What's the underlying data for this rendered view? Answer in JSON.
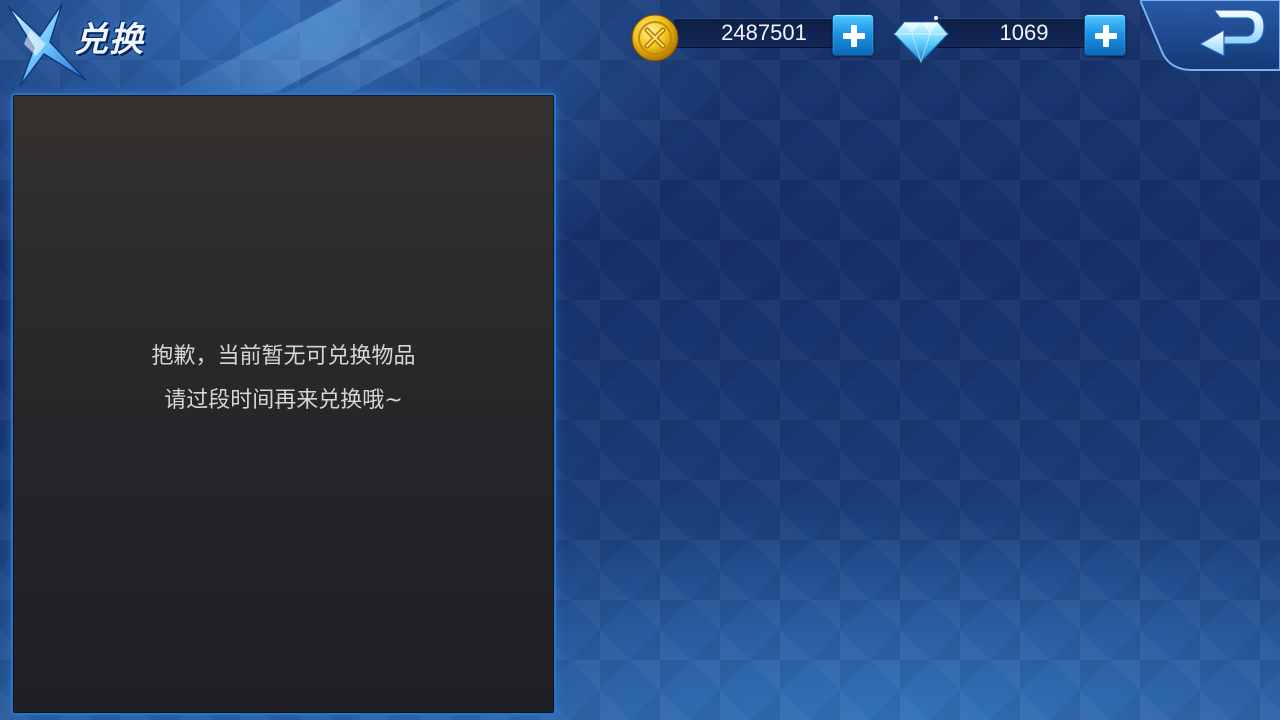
{
  "header": {
    "title": "兑换",
    "logo_icon": "x-logo-icon",
    "back_icon": "back-arrow-icon"
  },
  "currencies": {
    "gold": {
      "icon": "gold-coin-icon",
      "amount": "2487501"
    },
    "diamond": {
      "icon": "diamond-icon",
      "amount": "1069"
    }
  },
  "panel": {
    "empty_line1": "抱歉，当前暂无可兑换物品",
    "empty_line2": "请过段时间再来兑换哦~"
  },
  "colors": {
    "accent_blue": "#1a8fe0",
    "panel_border": "#2a72c8",
    "coin_gold": "#f2c21a"
  }
}
